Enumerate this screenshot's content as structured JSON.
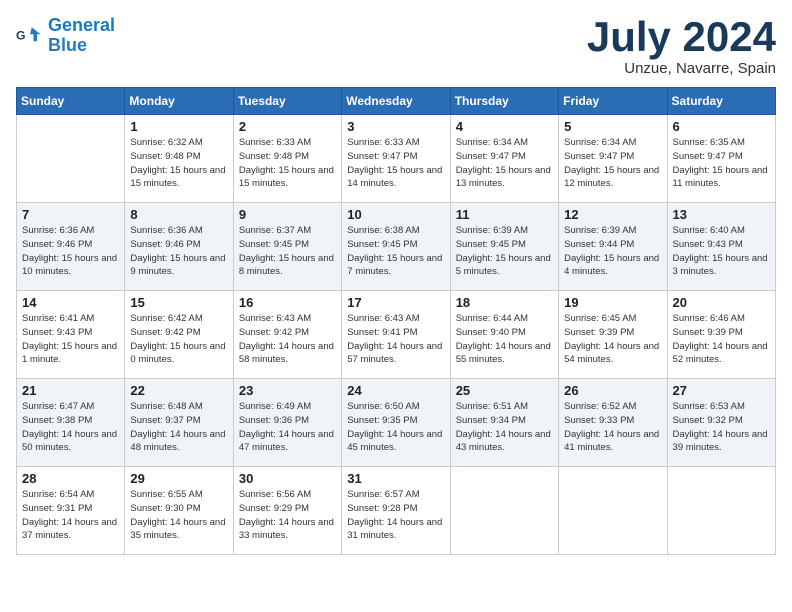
{
  "header": {
    "logo_line1": "General",
    "logo_line2": "Blue",
    "month_year": "July 2024",
    "location": "Unzue, Navarre, Spain"
  },
  "days_of_week": [
    "Sunday",
    "Monday",
    "Tuesday",
    "Wednesday",
    "Thursday",
    "Friday",
    "Saturday"
  ],
  "weeks": [
    [
      {
        "day": "",
        "info": ""
      },
      {
        "day": "1",
        "info": "Sunrise: 6:32 AM\nSunset: 9:48 PM\nDaylight: 15 hours\nand 15 minutes."
      },
      {
        "day": "2",
        "info": "Sunrise: 6:33 AM\nSunset: 9:48 PM\nDaylight: 15 hours\nand 15 minutes."
      },
      {
        "day": "3",
        "info": "Sunrise: 6:33 AM\nSunset: 9:47 PM\nDaylight: 15 hours\nand 14 minutes."
      },
      {
        "day": "4",
        "info": "Sunrise: 6:34 AM\nSunset: 9:47 PM\nDaylight: 15 hours\nand 13 minutes."
      },
      {
        "day": "5",
        "info": "Sunrise: 6:34 AM\nSunset: 9:47 PM\nDaylight: 15 hours\nand 12 minutes."
      },
      {
        "day": "6",
        "info": "Sunrise: 6:35 AM\nSunset: 9:47 PM\nDaylight: 15 hours\nand 11 minutes."
      }
    ],
    [
      {
        "day": "7",
        "info": "Sunrise: 6:36 AM\nSunset: 9:46 PM\nDaylight: 15 hours\nand 10 minutes."
      },
      {
        "day": "8",
        "info": "Sunrise: 6:36 AM\nSunset: 9:46 PM\nDaylight: 15 hours\nand 9 minutes."
      },
      {
        "day": "9",
        "info": "Sunrise: 6:37 AM\nSunset: 9:45 PM\nDaylight: 15 hours\nand 8 minutes."
      },
      {
        "day": "10",
        "info": "Sunrise: 6:38 AM\nSunset: 9:45 PM\nDaylight: 15 hours\nand 7 minutes."
      },
      {
        "day": "11",
        "info": "Sunrise: 6:39 AM\nSunset: 9:45 PM\nDaylight: 15 hours\nand 5 minutes."
      },
      {
        "day": "12",
        "info": "Sunrise: 6:39 AM\nSunset: 9:44 PM\nDaylight: 15 hours\nand 4 minutes."
      },
      {
        "day": "13",
        "info": "Sunrise: 6:40 AM\nSunset: 9:43 PM\nDaylight: 15 hours\nand 3 minutes."
      }
    ],
    [
      {
        "day": "14",
        "info": "Sunrise: 6:41 AM\nSunset: 9:43 PM\nDaylight: 15 hours\nand 1 minute."
      },
      {
        "day": "15",
        "info": "Sunrise: 6:42 AM\nSunset: 9:42 PM\nDaylight: 15 hours\nand 0 minutes."
      },
      {
        "day": "16",
        "info": "Sunrise: 6:43 AM\nSunset: 9:42 PM\nDaylight: 14 hours\nand 58 minutes."
      },
      {
        "day": "17",
        "info": "Sunrise: 6:43 AM\nSunset: 9:41 PM\nDaylight: 14 hours\nand 57 minutes."
      },
      {
        "day": "18",
        "info": "Sunrise: 6:44 AM\nSunset: 9:40 PM\nDaylight: 14 hours\nand 55 minutes."
      },
      {
        "day": "19",
        "info": "Sunrise: 6:45 AM\nSunset: 9:39 PM\nDaylight: 14 hours\nand 54 minutes."
      },
      {
        "day": "20",
        "info": "Sunrise: 6:46 AM\nSunset: 9:39 PM\nDaylight: 14 hours\nand 52 minutes."
      }
    ],
    [
      {
        "day": "21",
        "info": "Sunrise: 6:47 AM\nSunset: 9:38 PM\nDaylight: 14 hours\nand 50 minutes."
      },
      {
        "day": "22",
        "info": "Sunrise: 6:48 AM\nSunset: 9:37 PM\nDaylight: 14 hours\nand 48 minutes."
      },
      {
        "day": "23",
        "info": "Sunrise: 6:49 AM\nSunset: 9:36 PM\nDaylight: 14 hours\nand 47 minutes."
      },
      {
        "day": "24",
        "info": "Sunrise: 6:50 AM\nSunset: 9:35 PM\nDaylight: 14 hours\nand 45 minutes."
      },
      {
        "day": "25",
        "info": "Sunrise: 6:51 AM\nSunset: 9:34 PM\nDaylight: 14 hours\nand 43 minutes."
      },
      {
        "day": "26",
        "info": "Sunrise: 6:52 AM\nSunset: 9:33 PM\nDaylight: 14 hours\nand 41 minutes."
      },
      {
        "day": "27",
        "info": "Sunrise: 6:53 AM\nSunset: 9:32 PM\nDaylight: 14 hours\nand 39 minutes."
      }
    ],
    [
      {
        "day": "28",
        "info": "Sunrise: 6:54 AM\nSunset: 9:31 PM\nDaylight: 14 hours\nand 37 minutes."
      },
      {
        "day": "29",
        "info": "Sunrise: 6:55 AM\nSunset: 9:30 PM\nDaylight: 14 hours\nand 35 minutes."
      },
      {
        "day": "30",
        "info": "Sunrise: 6:56 AM\nSunset: 9:29 PM\nDaylight: 14 hours\nand 33 minutes."
      },
      {
        "day": "31",
        "info": "Sunrise: 6:57 AM\nSunset: 9:28 PM\nDaylight: 14 hours\nand 31 minutes."
      },
      {
        "day": "",
        "info": ""
      },
      {
        "day": "",
        "info": ""
      },
      {
        "day": "",
        "info": ""
      }
    ]
  ]
}
